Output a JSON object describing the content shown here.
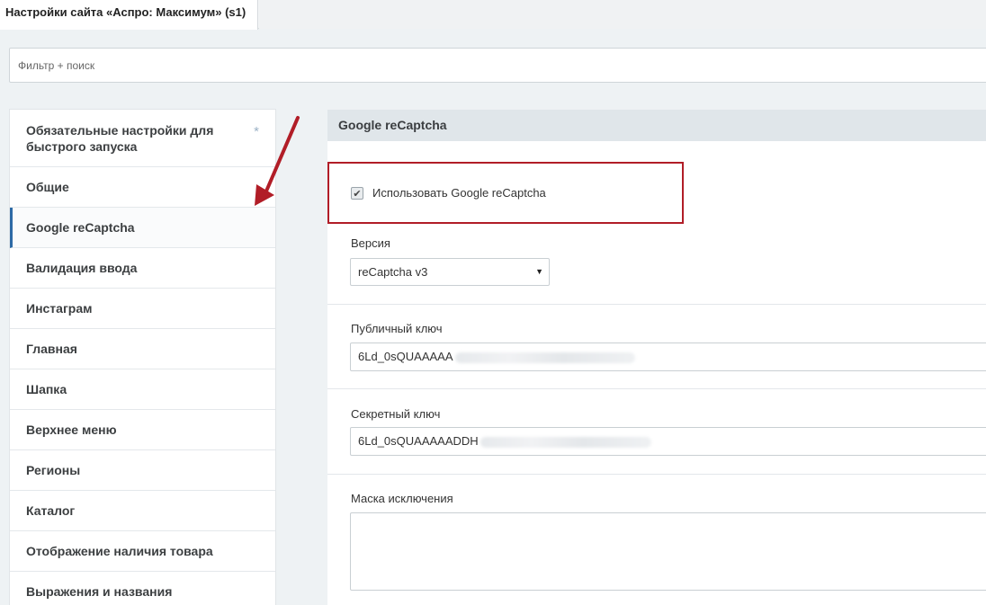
{
  "window": {
    "tab_title": "Настройки сайта «Аспро: Максимум» (s1)"
  },
  "filter": {
    "placeholder": "Фильтр + поиск"
  },
  "sidebar": {
    "items": [
      {
        "label": "Обязательные настройки для быстрого запуска",
        "icon": "star-icon",
        "star_glyph": "*"
      },
      {
        "label": "Общие"
      },
      {
        "label": "Google reCaptcha",
        "active": true
      },
      {
        "label": "Валидация ввода"
      },
      {
        "label": "Инстаграм"
      },
      {
        "label": "Главная"
      },
      {
        "label": "Шапка"
      },
      {
        "label": "Верхнее меню"
      },
      {
        "label": "Регионы"
      },
      {
        "label": "Каталог"
      },
      {
        "label": "Отображение наличия товара"
      },
      {
        "label": "Выражения и названия"
      }
    ]
  },
  "section": {
    "title": "Google reCaptcha",
    "use_recaptcha": {
      "label": "Использовать Google reCaptcha",
      "checked": true,
      "check_glyph": "✔"
    },
    "version": {
      "label": "Версия",
      "value": "reCaptcha v3",
      "caret": "▼"
    },
    "public_key": {
      "label": "Публичный ключ",
      "value_visible": "6Ld_0sQUAAAAA"
    },
    "secret_key": {
      "label": "Секретный ключ",
      "value_visible": "6Ld_0sQUAAAAADDH"
    },
    "mask": {
      "label": "Маска исключения",
      "value": ""
    }
  },
  "colors": {
    "highlight_border": "#b11d27",
    "arrow": "#b11d27",
    "active_accent": "#2d6aa6"
  }
}
